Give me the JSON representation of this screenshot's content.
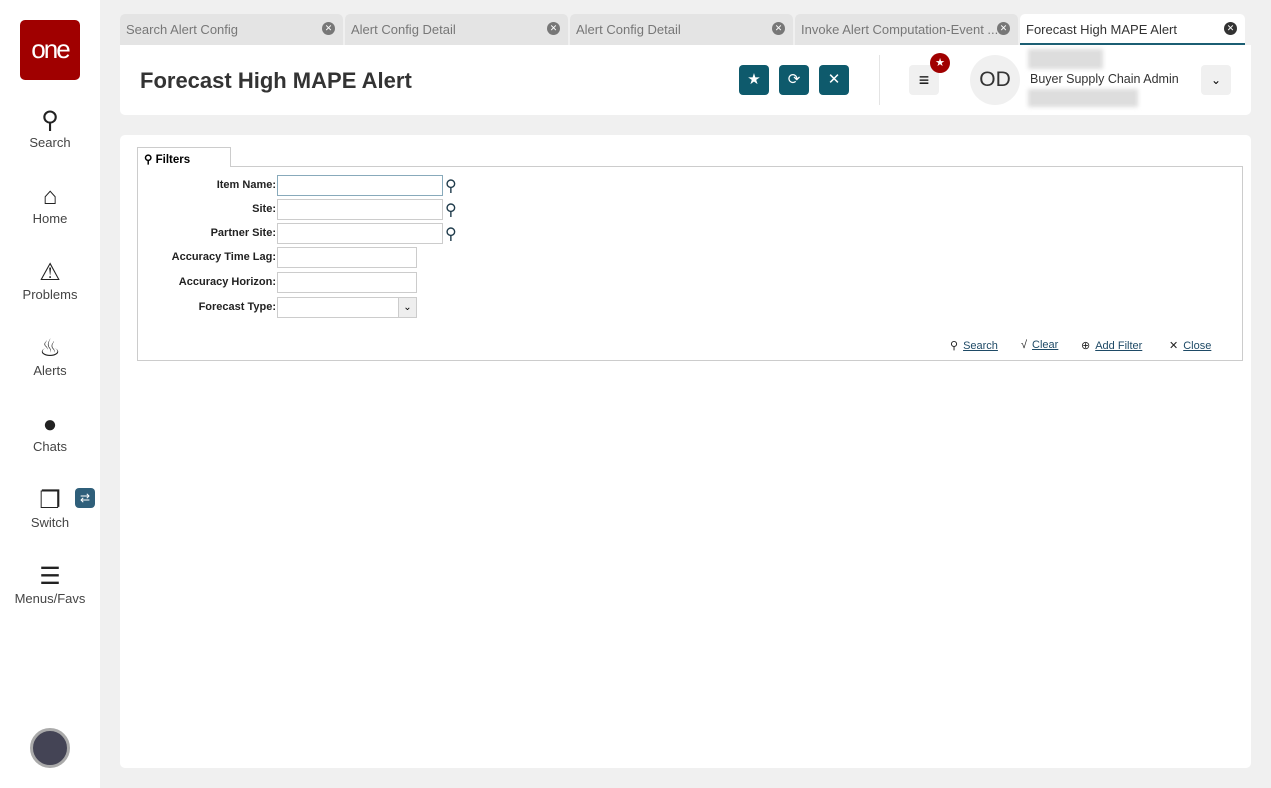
{
  "sidebar": {
    "logo": "one",
    "items": [
      {
        "label": "Search",
        "icon": "search-icon",
        "glyph": "🔍"
      },
      {
        "label": "Home",
        "icon": "home-icon",
        "glyph": "⌂"
      },
      {
        "label": "Problems",
        "icon": "warning-icon",
        "glyph": "⚠"
      },
      {
        "label": "Alerts",
        "icon": "bell-icon",
        "glyph": "🔔"
      },
      {
        "label": "Chats",
        "icon": "chat-icon",
        "glyph": "💬"
      },
      {
        "label": "Switch",
        "icon": "switch-icon",
        "glyph": "❐"
      },
      {
        "label": "Menus/Favs",
        "icon": "menu-icon",
        "glyph": "☰"
      }
    ]
  },
  "tabs": [
    {
      "label": "Search Alert Config"
    },
    {
      "label": "Alert Config Detail"
    },
    {
      "label": "Alert Config Detail"
    },
    {
      "label": "Invoke Alert Computation-Event ..."
    },
    {
      "label": "Forecast High MAPE Alert"
    }
  ],
  "header": {
    "title": "Forecast High MAPE Alert",
    "user_initials": "OD",
    "role": "Buyer Supply Chain Admin"
  },
  "filters": {
    "tab_label": "Filters",
    "fields": [
      {
        "label": "Item Name:",
        "value": ""
      },
      {
        "label": "Site:",
        "value": ""
      },
      {
        "label": "Partner Site:",
        "value": ""
      },
      {
        "label": "Accuracy Time Lag:",
        "value": ""
      },
      {
        "label": "Accuracy Horizon:",
        "value": ""
      },
      {
        "label": "Forecast Type:",
        "value": ""
      }
    ],
    "actions": {
      "search": "Search",
      "clear": "Clear",
      "add_filter": "Add Filter",
      "close": "Close"
    }
  },
  "colors": {
    "brand": "#a00000",
    "accent": "#0e5a6c"
  }
}
